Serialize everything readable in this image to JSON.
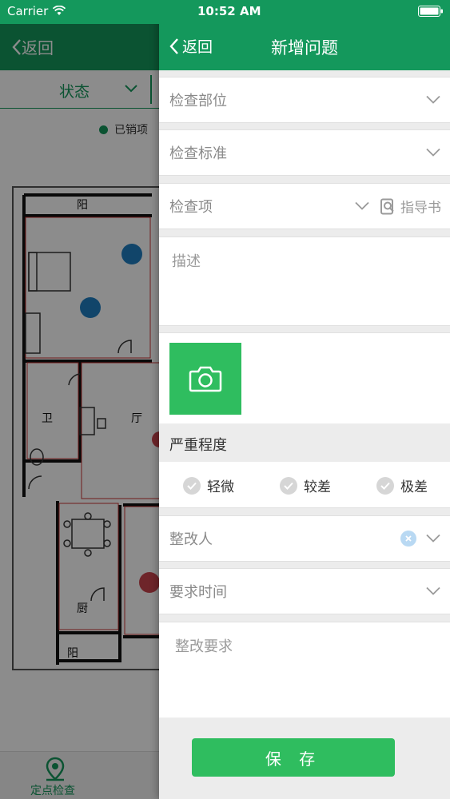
{
  "status_bar": {
    "carrier": "Carrier",
    "time": "10:52 AM"
  },
  "background": {
    "back_label": "返回",
    "filter_label": "状态",
    "legend_label": "已销项",
    "plan_labels": {
      "balcony_top": "阳",
      "bathroom": "卫",
      "hall": "厅",
      "kitchen": "厨",
      "balcony_bottom": "阳"
    },
    "tab_label": "定点检查",
    "colors": {
      "brand": "#14985c",
      "blue_marker": "#1f7fc2",
      "red_marker": "#c9444d"
    }
  },
  "nav": {
    "back_label": "返回",
    "title": "新增问题"
  },
  "form": {
    "inspection_part": "检查部位",
    "inspection_standard": "检查标准",
    "inspection_item": "检查项",
    "guide_book": "指导书",
    "description_placeholder": "描述",
    "severity_title": "严重程度",
    "severity_options": [
      "轻微",
      "较差",
      "极差"
    ],
    "rectifier": "整改人",
    "required_time": "要求时间",
    "rectify_requirement_placeholder": "整改要求"
  },
  "save_label": "保 存",
  "icons": [
    "wifi-icon",
    "battery-icon",
    "back-chevron-icon",
    "chevron-down-icon",
    "guide-book-icon",
    "camera-icon",
    "check-icon",
    "clear-icon",
    "location-icon"
  ]
}
